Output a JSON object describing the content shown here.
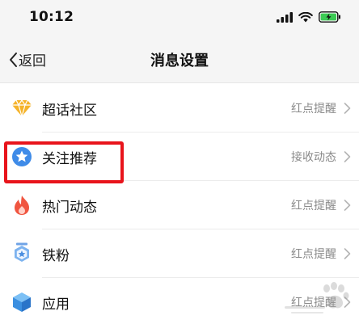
{
  "status": {
    "time": "10:12"
  },
  "nav": {
    "back_label": "返回",
    "title": "消息设置"
  },
  "settings": [
    {
      "label": "超话社区",
      "value": "红点提醒",
      "icon": "diamond-icon"
    },
    {
      "label": "关注推荐",
      "value": "接收动态",
      "icon": "star-badge-icon"
    },
    {
      "label": "热门动态",
      "value": "红点提醒",
      "icon": "flame-icon"
    },
    {
      "label": "铁粉",
      "value": "红点提醒",
      "icon": "medal-icon"
    },
    {
      "label": "应用",
      "value": "红点提醒",
      "icon": "cube-icon"
    }
  ],
  "colors": {
    "highlight": "#e8141b",
    "battery": "#3ccb54",
    "diamond": "#f5b32a",
    "star_badge": "#3f8be8",
    "flame": "#f05540",
    "cube": "#3b8fe0"
  }
}
